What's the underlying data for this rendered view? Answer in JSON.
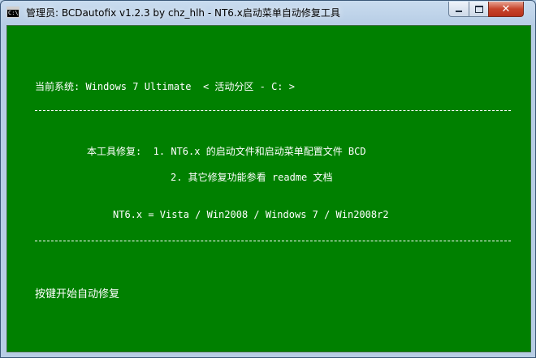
{
  "window": {
    "title": "管理员:  BCDautofix v1.2.3 by chz_hlh - NT6.x启动菜单自动修复工具",
    "icon": "console-icon",
    "icon_text": "C:\\",
    "controls": {
      "minimize": "minimize-icon",
      "maximize": "maximize-icon",
      "close": "✕"
    }
  },
  "console": {
    "background": "#008000",
    "foreground": "#ffffff",
    "system_line": "当前系统: Windows 7 Ultimate  < 活动分区 - C: >",
    "repair_line1": "本工具修复:  1. NT6.x 的启动文件和启动菜单配置文件 BCD",
    "repair_line2": "2. 其它修复功能参看 readme 文档",
    "nt6_line": "NT6.x = Vista / Win2008 / Windows 7 / Win2008r2",
    "prompt_line": "按键开始自动修复"
  }
}
